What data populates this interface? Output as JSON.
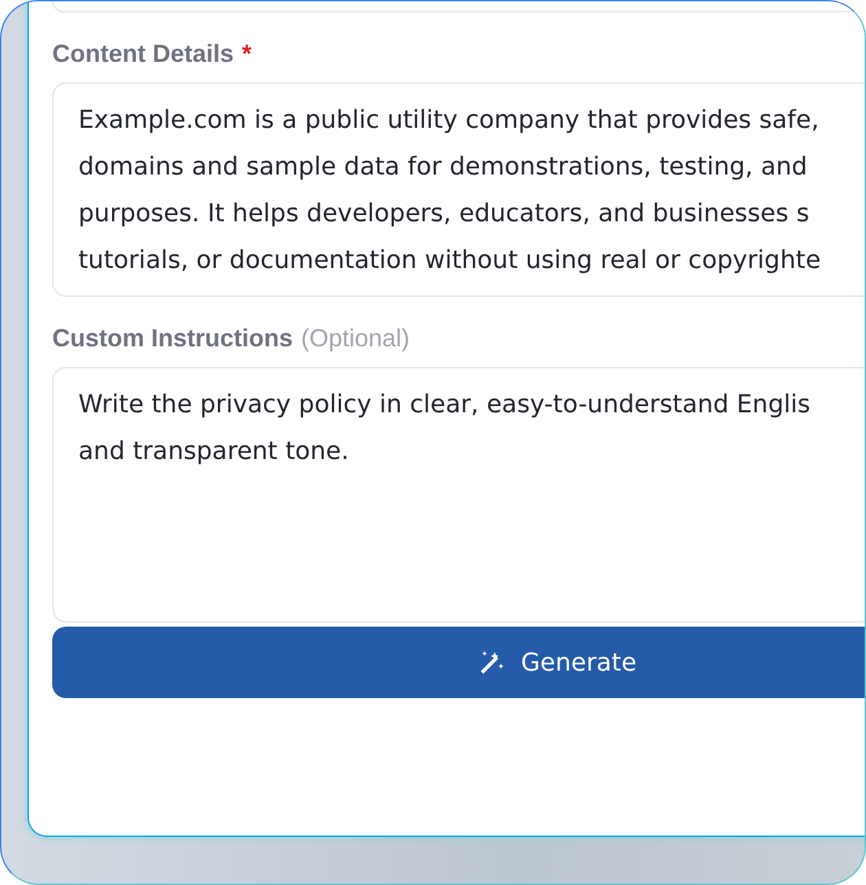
{
  "content_details": {
    "label": "Content Details",
    "required": true,
    "required_mark": "*",
    "lines": [
      "Example.com is a public utility company that provides safe,",
      "domains and sample data for demonstrations, testing, and",
      "purposes. It helps developers, educators, and businesses s",
      "tutorials, or documentation without using real or copyrighte"
    ]
  },
  "custom_instructions": {
    "label": "Custom Instructions",
    "hint": "(Optional)",
    "lines": [
      "Write the privacy policy in clear, easy-to-understand Englis",
      "and transparent tone."
    ]
  },
  "generate_button": {
    "label": "Generate"
  }
}
